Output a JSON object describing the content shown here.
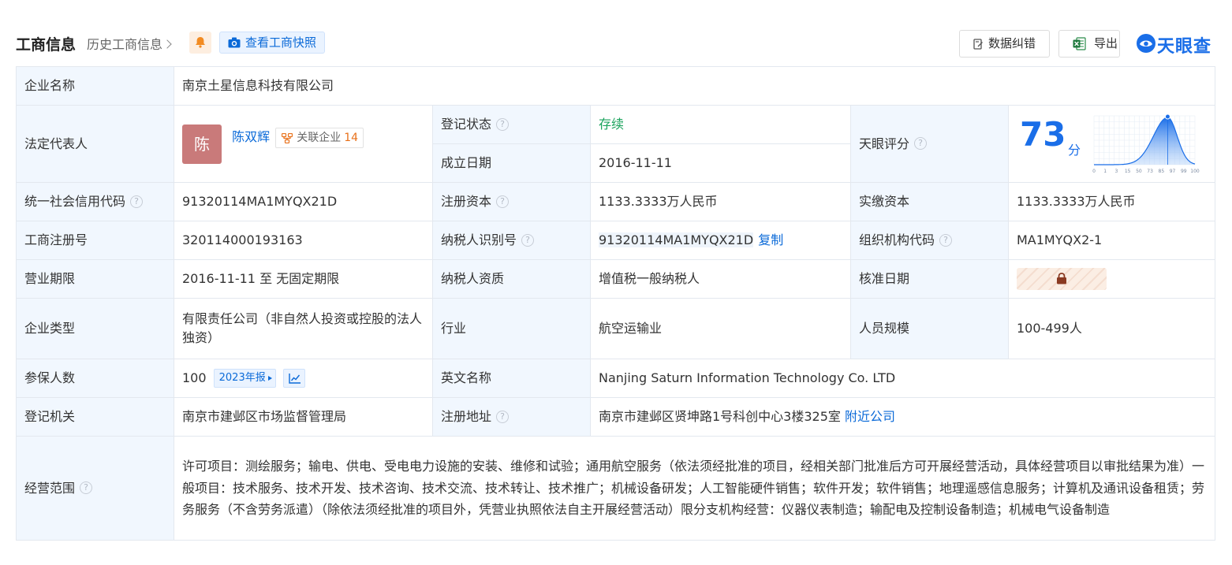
{
  "header": {
    "title": "工商信息",
    "history_link": "历史工商信息",
    "snapshot_button": "查看工商快照",
    "fix_button": "数据纠错",
    "export_button": "导出",
    "brand": "天眼查"
  },
  "fields": {
    "company_name": {
      "label": "企业名称",
      "value": "南京土星信息科技有限公司"
    },
    "legal_rep": {
      "label": "法定代表人",
      "avatar_char": "陈",
      "name": "陈双辉",
      "related_label": "关联企业",
      "related_count": "14"
    },
    "reg_status": {
      "label": "登记状态",
      "value": "存续"
    },
    "founded": {
      "label": "成立日期",
      "value": "2016-11-11"
    },
    "tianyan_score": {
      "label": "天眼评分",
      "score": "73",
      "unit": "分",
      "axis_ticks": [
        "0",
        "1",
        "3",
        "15",
        "50",
        "73",
        "85",
        "97",
        "99",
        "100"
      ],
      "score_fraction": 0.73
    },
    "credit_code": {
      "label": "统一社会信用代码",
      "value": "91320114MA1MYQX21D"
    },
    "reg_capital": {
      "label": "注册资本",
      "value": "1133.3333万人民币"
    },
    "paid_capital": {
      "label": "实缴资本",
      "value": "1133.3333万人民币"
    },
    "reg_number": {
      "label": "工商注册号",
      "value": "320114000193163"
    },
    "taxpayer_id": {
      "label": "纳税人识别号",
      "value": "91320114MA1MYQX21D",
      "copy": "复制"
    },
    "org_code": {
      "label": "组织机构代码",
      "value": "MA1MYQX2-1"
    },
    "business_term": {
      "label": "营业期限",
      "value": "2016-11-11 至 无固定期限"
    },
    "taxpayer_quality": {
      "label": "纳税人资质",
      "value": "增值税一般纳税人"
    },
    "approval_date": {
      "label": "核准日期"
    },
    "company_type": {
      "label": "企业类型",
      "value": "有限责任公司（非自然人投资或控股的法人独资）"
    },
    "industry": {
      "label": "行业",
      "value": "航空运输业"
    },
    "staff_size": {
      "label": "人员规模",
      "value": "100-499人"
    },
    "insured_count": {
      "label": "参保人数",
      "value": "100",
      "year_tag": "2023年报"
    },
    "english_name": {
      "label": "英文名称",
      "value": "Nanjing Saturn Information Technology Co. LTD"
    },
    "reg_authority": {
      "label": "登记机关",
      "value": "南京市建邺区市场监督管理局"
    },
    "reg_address": {
      "label": "注册地址",
      "value": "南京市建邺区贤坤路1号科创中心3楼325室",
      "nearby": "附近公司"
    },
    "business_scope": {
      "label": "经营范围",
      "value": "许可项目：测绘服务；输电、供电、受电电力设施的安装、维修和试验；通用航空服务（依法须经批准的项目，经相关部门批准后方可开展经营活动，具体经营项目以审批结果为准）一般项目：技术服务、技术开发、技术咨询、技术交流、技术转让、技术推广；机械设备研发；人工智能硬件销售；软件开发；软件销售；地理遥感信息服务；计算机及通讯设备租赁；劳务服务（不含劳务派遣）（除依法须经批准的项目外，凭营业执照依法自主开展经营活动）限分支机构经营：仪器仪表制造；输配电及控制设备制造；机械电气设备制造"
    }
  },
  "colors": {
    "accent": "#0b6ad8",
    "brand": "#1a6ee8",
    "label_bg": "#f1f7fe",
    "status_green": "#1aa35c",
    "count_orange": "#e8711a"
  }
}
